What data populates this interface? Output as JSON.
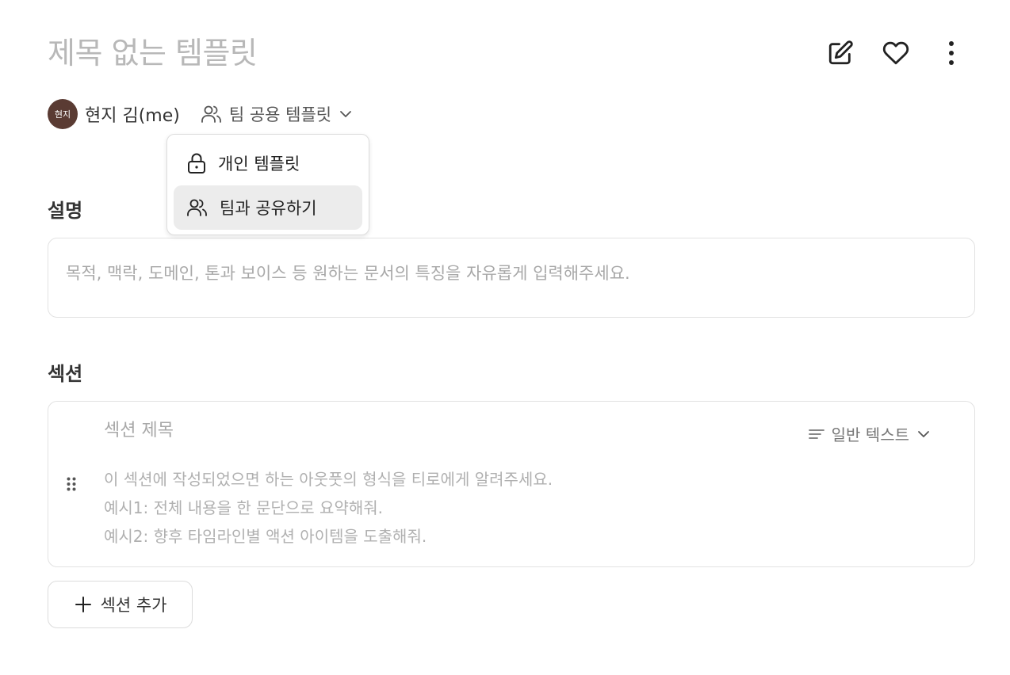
{
  "template": {
    "title": "제목 없는 템플릿"
  },
  "toolbar": {
    "icons": [
      "edit-icon",
      "heart-icon",
      "more-vertical-icon"
    ]
  },
  "author": {
    "avatar_text": "현지",
    "avatar_color": "#5a3b33",
    "name": "현지 김(me)"
  },
  "sharing": {
    "selected_label": "팀 공용 템플릿",
    "menu": [
      {
        "label": "개인 템플릿",
        "icon": "lock-icon",
        "active": false
      },
      {
        "label": "팀과 공유하기",
        "icon": "users-icon",
        "active": true
      }
    ]
  },
  "description": {
    "label": "설명",
    "placeholder": "목적, 맥락, 도메인, 톤과 보이스 등 원하는 문서의 특징을 자유롭게 입력해주세요."
  },
  "sections": {
    "label": "섹션",
    "items": [
      {
        "title_placeholder": "섹션 제목",
        "type_label": "일반 텍스트",
        "body_placeholder": "이 섹션에 작성되었으면 하는 아웃풋의 형식을 티로에게 알려주세요.\n예시1: 전체 내용을 한 문단으로 요약해줘.\n예시2: 향후 타임라인별 액션 아이템을 도출해줘."
      }
    ],
    "add_label": "섹션 추가"
  }
}
